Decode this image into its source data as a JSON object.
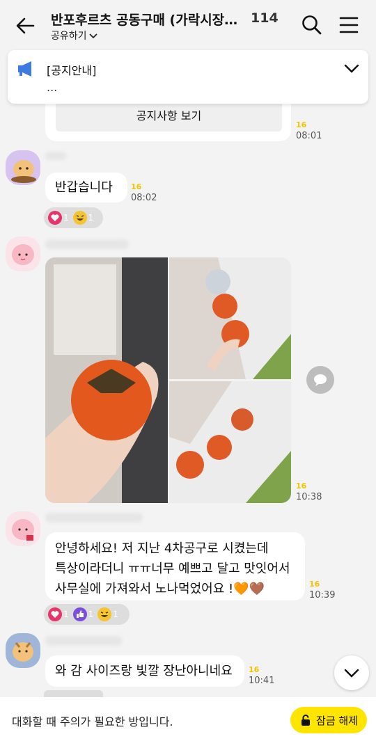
{
  "header": {
    "title": "반포후르츠 공동구매 (가락시장직...",
    "member_count": "114",
    "share_label": "공유하기"
  },
  "notice": {
    "title": "[공지안내]",
    "body": "..."
  },
  "messages": {
    "notice_card": {
      "button_label": "공지사항 보기",
      "unread": "16",
      "time": "08:01"
    },
    "greeting": {
      "text": "반갑습니다",
      "unread": "16",
      "time": "08:02",
      "reactions": [
        "1",
        "1"
      ]
    },
    "photos": {
      "unread": "16",
      "time": "10:38"
    },
    "review": {
      "lines": [
        "안녕하세요! 저 지난 4차공구로 시켰는데",
        "특상이라더니 ㅠㅠ너무 예쁘고 달고 맛잇어서",
        "사무실에 가져와서 노나먹었어요 !🧡🤎"
      ],
      "unread": "16",
      "time": "10:39",
      "reactions": [
        "1",
        "1",
        "1"
      ]
    },
    "reply": {
      "text": "와 감 사이즈랑 빛깔 장난아니네요",
      "unread": "16",
      "time": "10:41"
    }
  },
  "bottom": {
    "notice_text": "대화할 때 주의가 필요한 방입니다.",
    "unlock_label": "잠금 해제"
  },
  "colors": {
    "background": "#f3f3f3",
    "bubble": "#ffffff",
    "unread": "#f0c400",
    "unlock_button": "#fee500",
    "notice_icon": "#3d7be0",
    "heart": "#e8336b",
    "thumb": "#7a4fe0"
  },
  "icons": [
    "back-arrow-icon",
    "chevron-down-icon",
    "search-icon",
    "menu-icon",
    "megaphone-icon",
    "chat-bubble-icon",
    "heart-icon",
    "thumbs-up-icon",
    "laugh-emoji-icon",
    "lock-icon"
  ]
}
